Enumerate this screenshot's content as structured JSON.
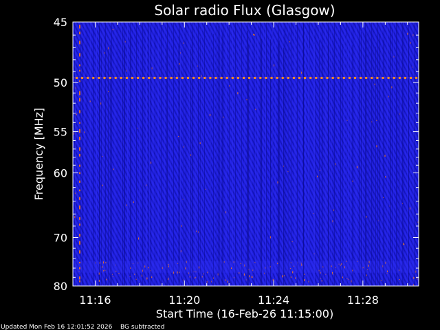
{
  "chart_data": {
    "type": "heatmap",
    "title": "Solar radio Flux (Glasgow)",
    "xlabel": "Start Time (16-Feb-26 11:15:00)",
    "ylabel": "Frequency [MHz]",
    "footer_left": "Updated Mon Feb 16 12:01:52 2026",
    "footer_right": "BG subtracted",
    "x_range_minutes": [
      0,
      15.5
    ],
    "x_ticks": [
      {
        "minute": 1,
        "label": "11:16"
      },
      {
        "minute": 5,
        "label": "11:20"
      },
      {
        "minute": 9,
        "label": "11:24"
      },
      {
        "minute": 13,
        "label": "11:28"
      }
    ],
    "y_scale": "reciprocal",
    "y_range_mhz": [
      45,
      80
    ],
    "y_ticks": [
      {
        "value": 45,
        "label": "45"
      },
      {
        "value": 50,
        "label": "50"
      },
      {
        "value": 55,
        "label": "55"
      },
      {
        "value": 60,
        "label": "60"
      },
      {
        "value": 70,
        "label": "70"
      },
      {
        "value": 80,
        "label": "80"
      }
    ],
    "features": [
      {
        "kind": "persistent-emission-line",
        "frequency_mhz": 49.6
      },
      {
        "kind": "enhanced-band",
        "frequency_range_mhz": [
          74.5,
          77.0
        ]
      }
    ],
    "colors": {
      "background": "#000000",
      "spectrum_base": "#1a1ad9",
      "spectrum_dark": "#0c0c8a",
      "spectrum_light": "#2e2ef0",
      "hot": "#ff7a1a",
      "line": "#ff8c1e",
      "text": "#ffffff"
    }
  }
}
